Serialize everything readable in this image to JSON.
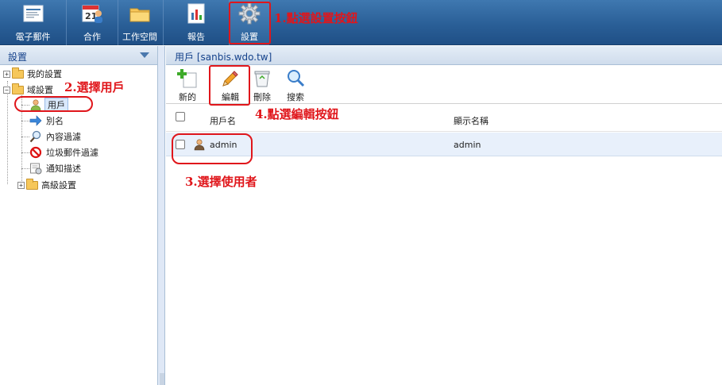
{
  "topbar": {
    "items": [
      {
        "label": "電子郵件",
        "icon": "email-icon"
      },
      {
        "label": "合作",
        "icon": "calendar-contacts-icon"
      },
      {
        "label": "工作空間",
        "icon": "folder-icon"
      },
      {
        "label": "報告",
        "icon": "report-icon"
      },
      {
        "label": "設置",
        "icon": "gear-icon"
      }
    ],
    "active": "設置"
  },
  "left": {
    "title": "設置",
    "tree": [
      {
        "label": "我的設置",
        "expander": "+",
        "icon": "folder-icon"
      },
      {
        "label": "域設置",
        "expander": "−",
        "icon": "folder-open-icon"
      },
      {
        "label": "用戶",
        "icon": "user-icon",
        "selected": true
      },
      {
        "label": "別名",
        "icon": "arrow-right-icon"
      },
      {
        "label": "內容過濾",
        "icon": "magnifier-icon"
      },
      {
        "label": "垃圾郵件過濾",
        "icon": "block-icon"
      },
      {
        "label": "通知描述",
        "icon": "notification-icon"
      },
      {
        "label": "高級設置",
        "expander": "+",
        "icon": "folder-icon"
      }
    ]
  },
  "right": {
    "title": "用戶 [sanbis.wdo.tw]",
    "toolbar": [
      {
        "label": "新的",
        "icon": "add-icon"
      },
      {
        "label": "編輯",
        "icon": "pencil-icon"
      },
      {
        "label": "刪除",
        "icon": "trash-icon"
      },
      {
        "label": "搜索",
        "icon": "search-icon"
      }
    ],
    "columns": {
      "username": "用戶名",
      "display_name": "顯示名稱"
    },
    "rows": [
      {
        "username": "admin",
        "display_name": "admin"
      }
    ]
  },
  "annotations": {
    "a1": "1.點選設置按鈕",
    "a2": "2.選擇用戶",
    "a3": "3.選擇使用者",
    "a4": "4.點選編輯按鈕"
  },
  "colors": {
    "topbar": "#2a5f97",
    "annotation": "#e0161b",
    "selected_row": "#e8f0fb"
  }
}
